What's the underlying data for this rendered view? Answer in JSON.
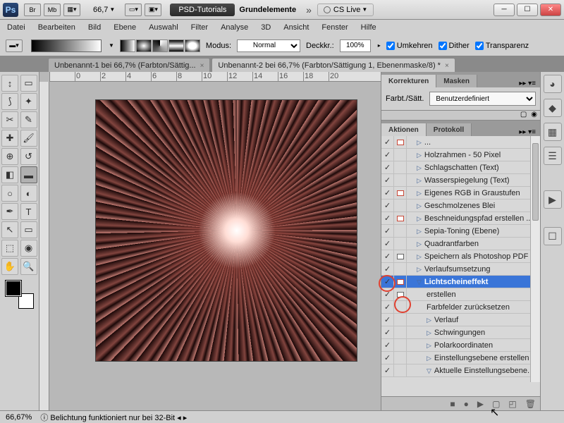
{
  "titlebar": {
    "zoom_dd": "66,7",
    "workspace1": "PSD-Tutorials",
    "workspace2": "Grundelemente",
    "cslive": "CS Live"
  },
  "menu": [
    "Datei",
    "Bearbeiten",
    "Bild",
    "Ebene",
    "Auswahl",
    "Filter",
    "Analyse",
    "3D",
    "Ansicht",
    "Fenster",
    "Hilfe"
  ],
  "options": {
    "mode_label": "Modus:",
    "mode_value": "Normal",
    "opacity_label": "Deckkr.:",
    "opacity_value": "100%",
    "reverse": "Umkehren",
    "dither": "Dither",
    "transparency": "Transparenz"
  },
  "tabs": {
    "t1": "Unbenannt-1 bei 66,7% (Farbton/Sättig...",
    "t2": "Unbenannt-2 bei 66,7% (Farbton/Sättigung 1, Ebenenmaske/8) *"
  },
  "korrekturen": {
    "tab1": "Korrekturen",
    "tab2": "Masken",
    "label": "Farbt./Sätt.",
    "preset": "Benutzerdefiniert"
  },
  "aktionen": {
    "tab1": "Aktionen",
    "tab2": "Protokoll",
    "rows": [
      {
        "c": true,
        "d": "red",
        "i": 1,
        "tri": "▷",
        "label": "...",
        "cut": true
      },
      {
        "c": true,
        "d": "",
        "i": 1,
        "tri": "▷",
        "label": "Holzrahmen - 50 Pixel"
      },
      {
        "c": true,
        "d": "",
        "i": 1,
        "tri": "▷",
        "label": "Schlagschatten (Text)"
      },
      {
        "c": true,
        "d": "",
        "i": 1,
        "tri": "▷",
        "label": "Wasserspiegelung (Text)"
      },
      {
        "c": true,
        "d": "red",
        "i": 1,
        "tri": "▷",
        "label": "Eigenes RGB in Graustufen"
      },
      {
        "c": true,
        "d": "",
        "i": 1,
        "tri": "▷",
        "label": "Geschmolzenes Blei"
      },
      {
        "c": true,
        "d": "red",
        "i": 1,
        "tri": "▷",
        "label": "Beschneidungspfad erstellen ..."
      },
      {
        "c": true,
        "d": "",
        "i": 1,
        "tri": "▷",
        "label": "Sepia-Toning (Ebene)"
      },
      {
        "c": true,
        "d": "",
        "i": 1,
        "tri": "▷",
        "label": "Quadrantfarben"
      },
      {
        "c": true,
        "d": "gray",
        "i": 1,
        "tri": "▷",
        "label": "Speichern als Photoshop PDF"
      },
      {
        "c": true,
        "d": "",
        "i": 1,
        "tri": "▷",
        "label": "Verlaufsumsetzung"
      },
      {
        "c": true,
        "d": "red",
        "i": 1,
        "tri": "▽",
        "label": "Lichtscheineffekt",
        "sel": true
      },
      {
        "c": true,
        "d": "gray",
        "i": 2,
        "tri": "",
        "label": "erstellen",
        "hl": true
      },
      {
        "c": true,
        "d": "",
        "i": 2,
        "tri": "",
        "label": "Farbfelder zurücksetzen"
      },
      {
        "c": true,
        "d": "",
        "i": 2,
        "tri": "▷",
        "label": "Verlauf"
      },
      {
        "c": true,
        "d": "",
        "i": 2,
        "tri": "▷",
        "label": "Schwingungen"
      },
      {
        "c": true,
        "d": "",
        "i": 2,
        "tri": "▷",
        "label": "Polarkoordinaten"
      },
      {
        "c": true,
        "d": "",
        "i": 2,
        "tri": "▷",
        "label": "Einstellungsebene erstellen"
      },
      {
        "c": true,
        "d": "",
        "i": 2,
        "tri": "▽",
        "label": "Aktuelle Einstellungsebene..."
      }
    ]
  },
  "status": {
    "zoom": "66,67%",
    "msg": "Belichtung funktioniert nur bei 32-Bit"
  }
}
